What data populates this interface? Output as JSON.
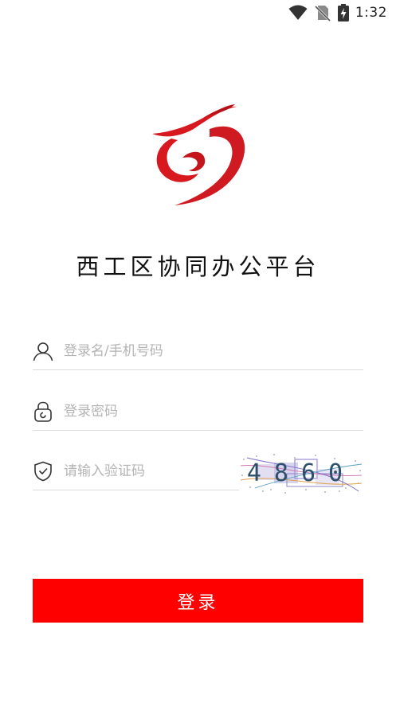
{
  "status_bar": {
    "time": "1:32",
    "icons": [
      "wifi-icon",
      "no-sim-icon",
      "battery-charging-icon"
    ]
  },
  "app": {
    "title": "西工区协同办公平台",
    "brand_color": "#ff0000",
    "logo": "red-swirl-logo"
  },
  "form": {
    "username": {
      "placeholder": "登录名/手机号码",
      "value": "",
      "icon": "user-icon"
    },
    "password": {
      "placeholder": "登录密码",
      "value": "",
      "icon": "lock-icon"
    },
    "captcha": {
      "placeholder": "请输入验证码",
      "value": "",
      "icon": "shield-check-icon",
      "code": "4860"
    },
    "submit_label": "登录"
  }
}
